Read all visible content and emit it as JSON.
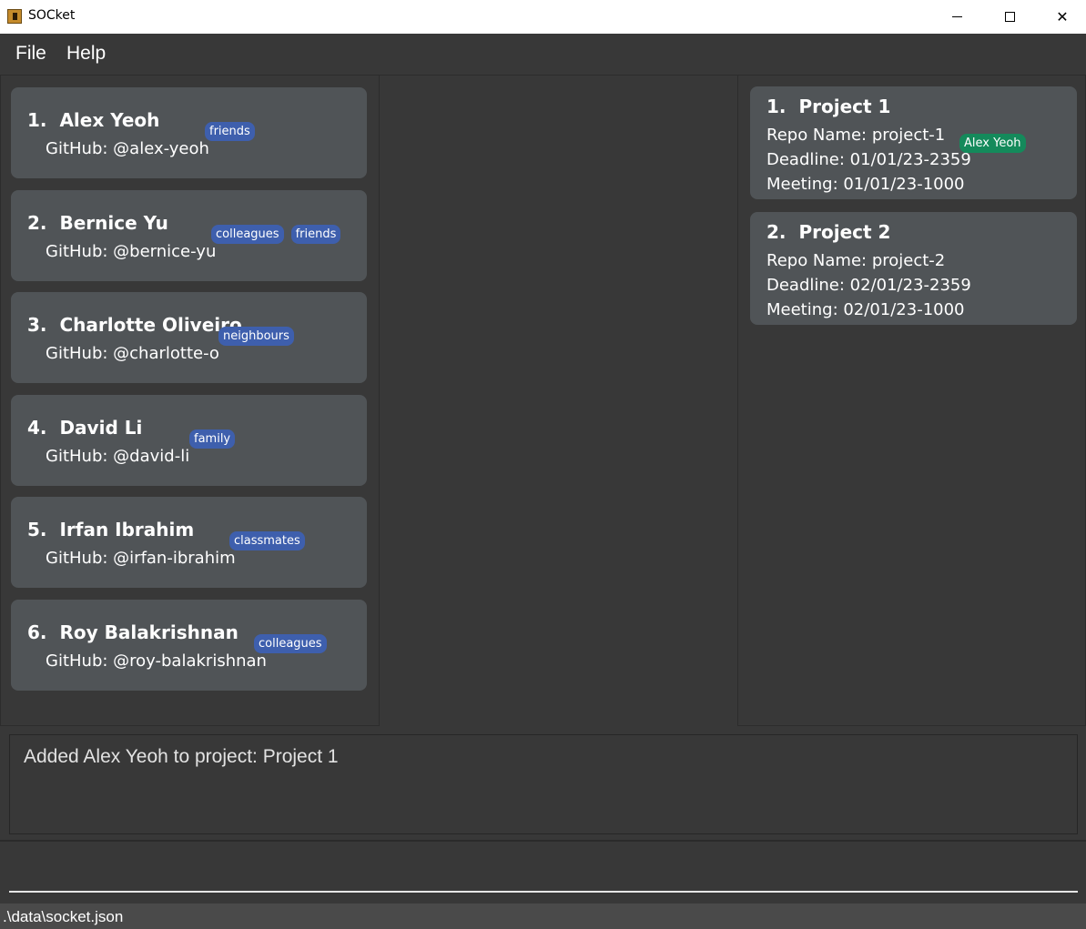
{
  "window": {
    "title": "SOCket",
    "minimize": "—",
    "maximize": "□",
    "close": "✕"
  },
  "menu": {
    "file": "File",
    "help": "Help"
  },
  "persons": [
    {
      "index": "1.",
      "name": "Alex Yeoh",
      "github": "GitHub: @alex-yeoh",
      "tags": [
        "friends"
      ]
    },
    {
      "index": "2.",
      "name": "Bernice Yu",
      "github": "GitHub: @bernice-yu",
      "tags": [
        "colleagues",
        "friends"
      ]
    },
    {
      "index": "3.",
      "name": "Charlotte Oliveiro",
      "github": "GitHub: @charlotte-o",
      "tags": [
        "neighbours"
      ]
    },
    {
      "index": "4.",
      "name": "David Li",
      "github": "GitHub: @david-li",
      "tags": [
        "family"
      ]
    },
    {
      "index": "5.",
      "name": "Irfan Ibrahim",
      "github": "GitHub: @irfan-ibrahim",
      "tags": [
        "classmates"
      ]
    },
    {
      "index": "6.",
      "name": "Roy Balakrishnan",
      "github": "GitHub: @roy-balakrishnan",
      "tags": [
        "colleagues"
      ]
    }
  ],
  "projects": [
    {
      "index": "1.",
      "name": "Project 1",
      "repo": "Repo Name: project-1",
      "deadline": "Deadline: 01/01/23-2359",
      "meeting": "Meeting: 01/01/23-1000",
      "members": [
        "Alex Yeoh"
      ]
    },
    {
      "index": "2.",
      "name": "Project 2",
      "repo": "Repo Name: project-2",
      "deadline": "Deadline: 02/01/23-2359",
      "meeting": "Meeting: 02/01/23-1000",
      "members": []
    }
  ],
  "result": {
    "message": "Added Alex Yeoh to project: Project 1"
  },
  "command": {
    "value": ""
  },
  "status": {
    "path": ".\\data\\socket.json"
  },
  "colors": {
    "background": "#383838",
    "card": "#505457",
    "tag": "#3e5fad",
    "member_tag": "#148a5b"
  }
}
